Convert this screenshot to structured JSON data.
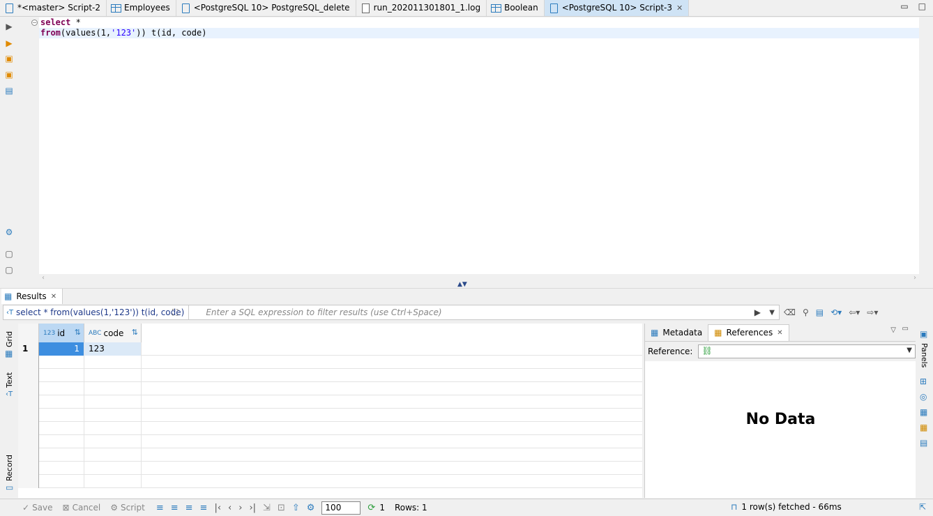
{
  "tabs": [
    {
      "label": "*<master> Script-2",
      "icon": "script-icon"
    },
    {
      "label": "Employees",
      "icon": "table-icon"
    },
    {
      "label": "<PostgreSQL 10> PostgreSQL_delete",
      "icon": "script-icon"
    },
    {
      "label": "run_202011301801_1.log",
      "icon": "log-file-icon"
    },
    {
      "label": "Boolean",
      "icon": "table-icon"
    },
    {
      "label": "<PostgreSQL 10> Script-3",
      "icon": "script-icon",
      "active": true
    }
  ],
  "editor": {
    "line1_kw": "select",
    "line1_rest": " *",
    "line2_fn": "from",
    "line2_a": "(values(1,",
    "line2_str": "'123'",
    "line2_b": ")) t(id, code)"
  },
  "results": {
    "tab_label": "Results",
    "filter_query": "select * from(values(1,'123')) t(id, code)",
    "filter_placeholder": "Enter a SQL expression to filter results (use Ctrl+Space)",
    "strip_labels": {
      "grid": "Grid",
      "text": "Text",
      "record": "Record"
    },
    "columns": [
      {
        "type": "123",
        "name": "id"
      },
      {
        "type": "ABC",
        "name": "code"
      }
    ],
    "rows": [
      {
        "num": "1",
        "id": "1",
        "code": "123"
      }
    ]
  },
  "panel": {
    "tab_metadata": "Metadata",
    "tab_references": "References",
    "reference_label": "Reference:",
    "no_data": "No Data",
    "panels_label": "Panels"
  },
  "status": {
    "save": "Save",
    "cancel": "Cancel",
    "script": "Script",
    "fetch_size": "100",
    "refresh_count": "1",
    "rows": "Rows: 1",
    "fetched": "1 row(s) fetched - 66ms"
  }
}
